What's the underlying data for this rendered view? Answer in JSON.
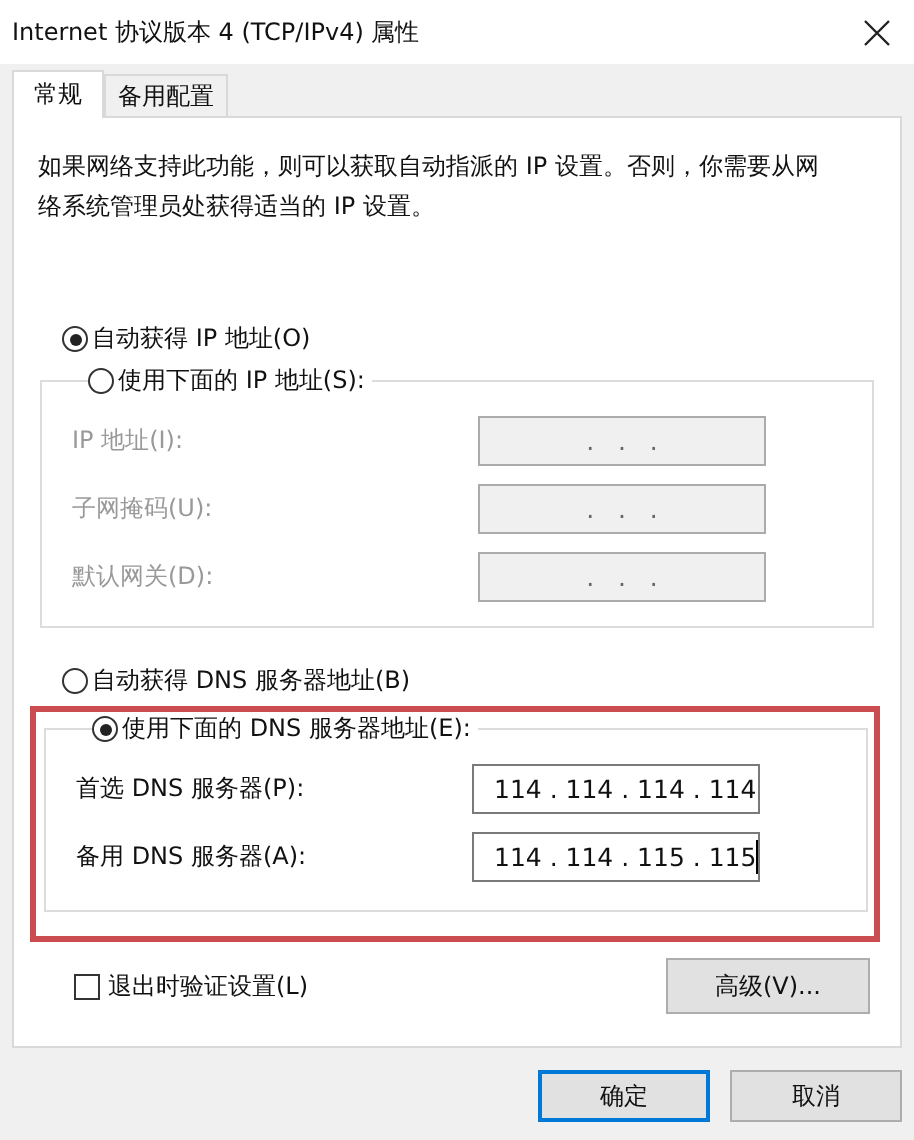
{
  "window": {
    "title": "Internet 协议版本 4 (TCP/IPv4) 属性"
  },
  "tabs": [
    {
      "label": "常规",
      "selected": true
    },
    {
      "label": "备用配置",
      "selected": false
    }
  ],
  "description": "如果网络支持此功能，则可以获取自动指派的 IP 设置。否则，你需要从网络系统管理员处获得适当的 IP 设置。",
  "ip_section": {
    "auto_option": {
      "label": "自动获得 IP 地址(O)",
      "selected": true
    },
    "manual_option": {
      "label": "使用下面的 IP 地址(S):",
      "selected": false
    },
    "fields": [
      {
        "label": "IP 地址(I):",
        "value": ".   .   .",
        "disabled": true
      },
      {
        "label": "子网掩码(U):",
        "value": ".   .   .",
        "disabled": true
      },
      {
        "label": "默认网关(D):",
        "value": ".   .   .",
        "disabled": true
      }
    ]
  },
  "dns_section": {
    "auto_option": {
      "label": "自动获得 DNS 服务器地址(B)",
      "selected": false
    },
    "manual_option": {
      "label": "使用下面的 DNS 服务器地址(E):",
      "selected": true
    },
    "fields": [
      {
        "label": "首选 DNS 服务器(P):",
        "value": "114 . 114 . 114 . 114",
        "disabled": false,
        "focused": false
      },
      {
        "label": "备用 DNS 服务器(A):",
        "value": "114 . 114 . 115 . 115",
        "disabled": false,
        "focused": true
      }
    ]
  },
  "validate_checkbox": {
    "label": "退出时验证设置(L)",
    "checked": false
  },
  "advanced_button": "高级(V)...",
  "buttons": [
    {
      "label": "确定",
      "default": true
    },
    {
      "label": "取消",
      "default": false
    }
  ]
}
